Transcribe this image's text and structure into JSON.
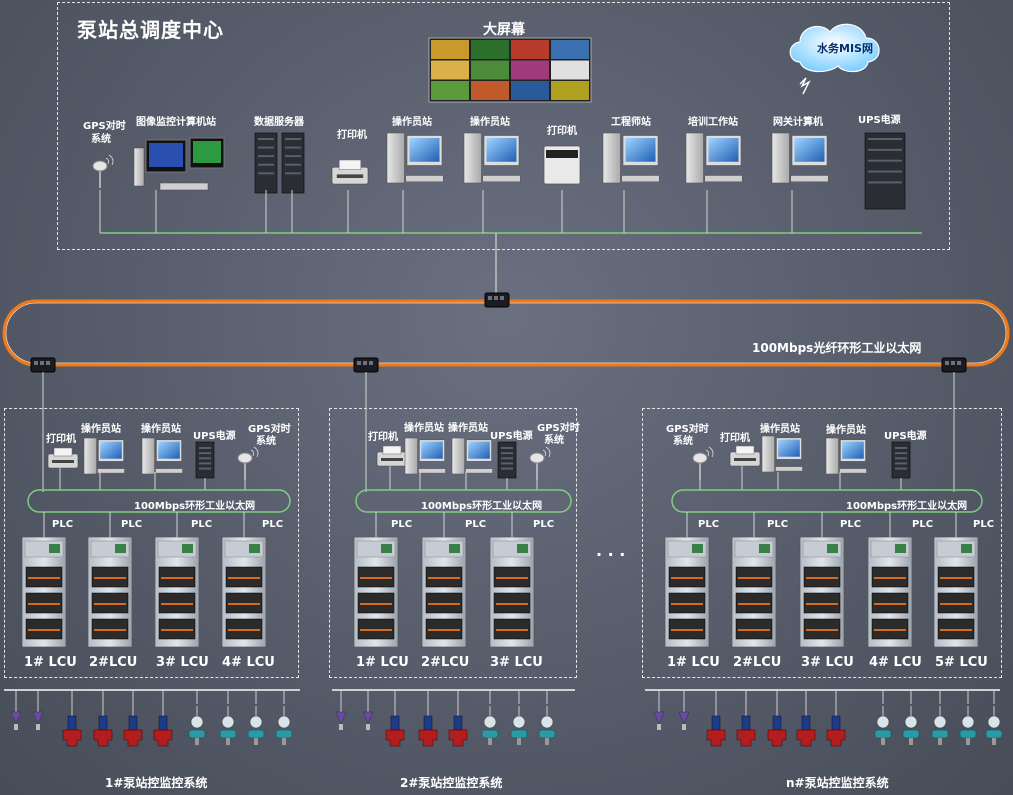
{
  "center": {
    "title": "泵站总调度中心",
    "screen": "大屏幕",
    "cloud": "水务MIS网",
    "devices": {
      "gps": [
        "GPS对时",
        "系统"
      ],
      "video": "图像监控计算机站",
      "server": "数据服务器",
      "printer1": "打印机",
      "op1": "操作员站",
      "op2": "操作员站",
      "printer2": "打印机",
      "eng": "工程师站",
      "train": "培训工作站",
      "gateway": "网关计算机",
      "ups": "UPS电源"
    }
  },
  "ring_label": "100Mbps光纤环形工业以太网",
  "dots": "· · ·",
  "stations": [
    {
      "devices": [
        "打印机",
        "操作员站",
        "操作员站",
        "UPS电源",
        "GPS对时",
        "系统"
      ],
      "ring": "100Mbps环形工业以太网",
      "plc": [
        "PLC",
        "PLC",
        "PLC",
        "PLC"
      ],
      "lcu": [
        "1# LCU",
        "2#LCU",
        "3# LCU",
        "4# LCU"
      ],
      "system": "1#泵站控监控系统"
    },
    {
      "devices": [
        "打印机",
        "操作员站",
        "操作员站",
        "UPS电源",
        "GPS对时",
        "系统"
      ],
      "ring": "100Mbps环形工业以太网",
      "plc": [
        "PLC",
        "PLC",
        "PLC"
      ],
      "lcu": [
        "1# LCU",
        "2#LCU",
        "3# LCU"
      ],
      "system": "2#泵站控监控系统"
    },
    {
      "devices": [
        "GPS对时",
        "系统",
        "打印机",
        "操作员站",
        "操作员站",
        "UPS电源"
      ],
      "ring": "100Mbps环形工业以太网",
      "plc": [
        "PLC",
        "PLC",
        "PLC",
        "PLC",
        "PLC"
      ],
      "lcu": [
        "1# LCU",
        "2#LCU",
        "3# LCU",
        "4# LCU",
        "5# LCU"
      ],
      "system": "n#泵站控监控系统"
    }
  ],
  "colors": {
    "ring": "#f07a1a",
    "net": "#7ed07e",
    "line": "#cfd8d0"
  }
}
